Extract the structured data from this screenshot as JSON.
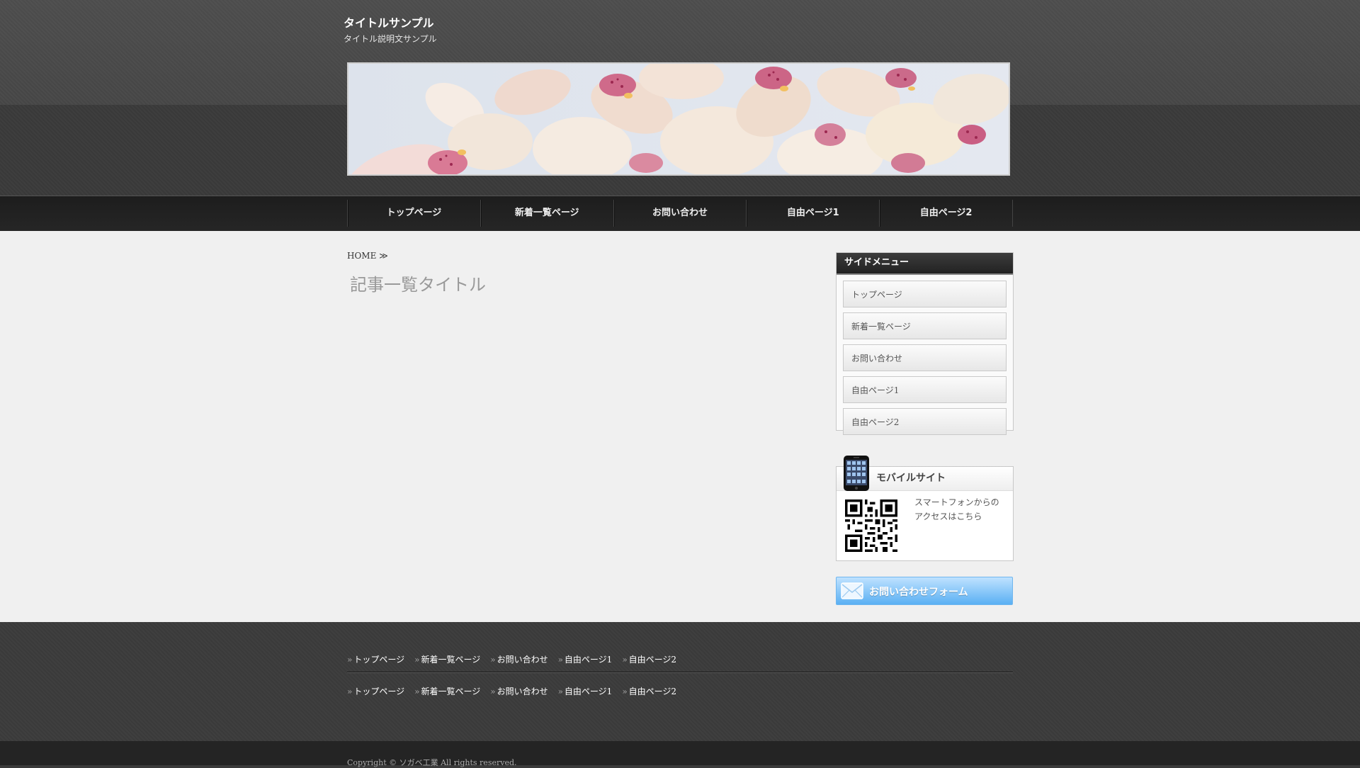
{
  "site": {
    "title": "タイトルサンプル",
    "description": "タイトル説明文サンプル"
  },
  "nav": {
    "items": [
      "トップページ",
      "新着一覧ページ",
      "お問い合わせ",
      "自由ページ1",
      "自由ページ2"
    ]
  },
  "breadcrumb": {
    "home": "HOME",
    "separator": "≫"
  },
  "main": {
    "page_title": "記事一覧タイトル"
  },
  "sidebar": {
    "menu_title": "サイドメニュー",
    "items": [
      "トップページ",
      "新着一覧ページ",
      "お問い合わせ",
      "自由ページ1",
      "自由ページ2"
    ],
    "mobile": {
      "title": "モバイルサイト",
      "text_line1": "スマートフォンからの",
      "text_line2": "アクセスはこちら"
    },
    "contact_button": "お問い合わせフォーム"
  },
  "footer": {
    "arrow": "»",
    "links_row1": [
      "トップページ",
      "新着一覧ページ",
      "お問い合わせ",
      "自由ページ1",
      "自由ページ2"
    ],
    "links_row2": [
      "トップページ",
      "新着一覧ページ",
      "お問い合わせ",
      "自由ページ1",
      "自由ページ2"
    ],
    "copyright": "Copyright © ソガベ工業 All rights reserved."
  },
  "colors": {
    "header_bg": "#4a4a4a",
    "nav_bg": "#222222",
    "main_bg": "#f0f0f0",
    "contact_button": "#5ab0f3"
  },
  "icons": {
    "phone": "smartphone-icon",
    "qr": "qr-code-icon",
    "mail": "mail-icon"
  }
}
